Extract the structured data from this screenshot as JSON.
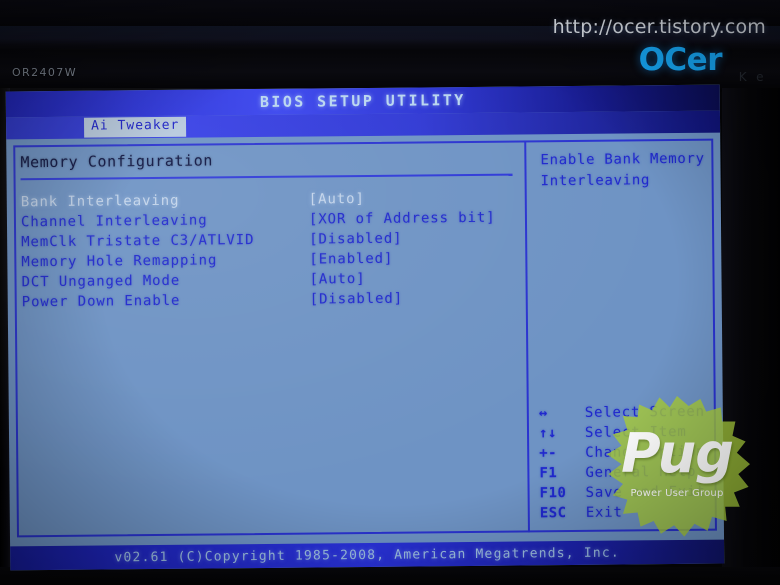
{
  "watermark": {
    "url": "http://ocer.tistory.com",
    "logo": "OCer",
    "pug_name": "Pug",
    "pug_tagline": "Power User Group"
  },
  "monitor": {
    "model": "OR2407W",
    "cert_left": "K",
    "cert_right": "e"
  },
  "screen": {
    "title": "BIOS SETUP UTILITY",
    "tab": "Ai Tweaker",
    "section_title": "Memory Configuration",
    "options": [
      {
        "label": "Bank Interleaving",
        "value": "[Auto]",
        "selected": true
      },
      {
        "label": "Channel Interleaving",
        "value": "[XOR of Address bit]",
        "selected": false
      },
      {
        "label": "MemClk Tristate C3/ATLVID",
        "value": "[Disabled]",
        "selected": false
      },
      {
        "label": "Memory Hole Remapping",
        "value": "[Enabled]",
        "selected": false
      },
      {
        "label": "DCT Unganged Mode",
        "value": "[Auto]",
        "selected": false
      },
      {
        "label": "Power Down Enable",
        "value": "[Disabled]",
        "selected": false
      }
    ],
    "help_text": "Enable Bank Memory Interleaving",
    "legend": [
      {
        "key": "↔",
        "desc": "Select Screen"
      },
      {
        "key": "↑↓",
        "desc": "Select Item"
      },
      {
        "key": "+-",
        "desc": "Change Option"
      },
      {
        "key": "F1",
        "desc": "General Help"
      },
      {
        "key": "F10",
        "desc": "Save and Exit"
      },
      {
        "key": "ESC",
        "desc": "Exit"
      }
    ],
    "footer": "v02.61 (C)Copyright 1985-2008, American Megatrends, Inc."
  },
  "colors": {
    "screen_bg": "#6e93c4",
    "accent_blue": "#2a33d0",
    "text_blue": "#2028cd",
    "selected_text": "#c3d4ea",
    "title_text": "#b9d6ef",
    "pug_green": "#a7cc3c",
    "logo_blue": "#16a7f5"
  }
}
